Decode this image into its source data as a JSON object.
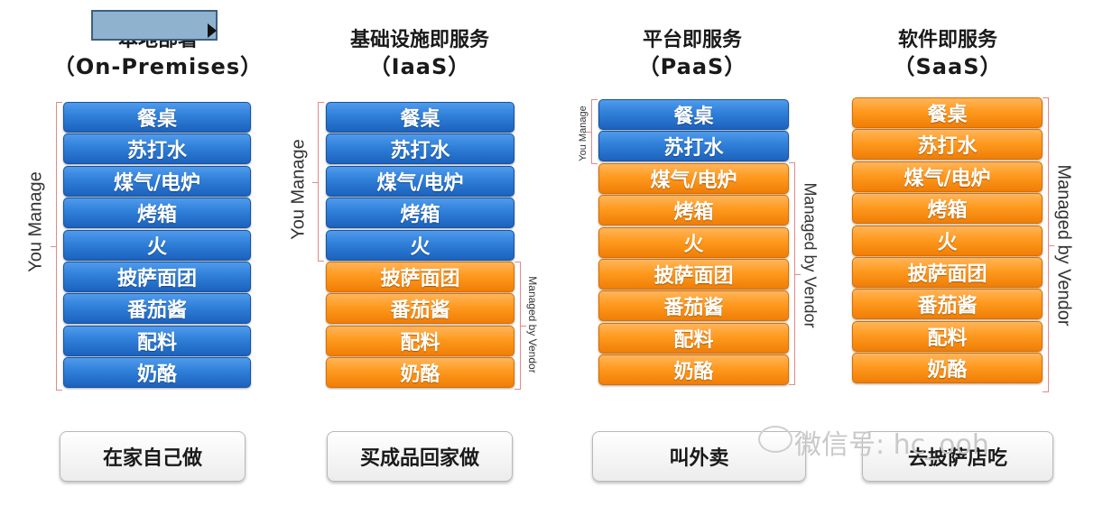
{
  "block_labels": [
    "餐桌",
    "苏打水",
    "煤气/电炉",
    "烤箱",
    "火",
    "披萨面团",
    "番茄酱",
    "配料",
    "奶酪"
  ],
  "columns": [
    {
      "title": "本地部署",
      "subtitle": "（On-Premises）",
      "managed_count": 9,
      "bottom_label": "在家自己做",
      "left_label": "You Manage",
      "right_label": ""
    },
    {
      "title": "基础设施即服务",
      "subtitle": "（IaaS）",
      "managed_count": 5,
      "bottom_label": "买成品回家做",
      "left_label": "You Manage",
      "right_label": "Managed by Vendor"
    },
    {
      "title": "平台即服务",
      "subtitle": "（PaaS）",
      "managed_count": 2,
      "bottom_label": "叫外卖",
      "left_label": "You Manage",
      "right_label": "Managed by Vendor"
    },
    {
      "title": "软件即服务",
      "subtitle": "（SaaS）",
      "managed_count": 0,
      "bottom_label": "去披萨店吃",
      "left_label": "",
      "right_label": "Managed by Vendor"
    }
  ],
  "colors": {
    "you_manage": "#2f7fd8",
    "vendor_managed": "#ff9a1f"
  },
  "watermark": "微信号: hc_ooh"
}
